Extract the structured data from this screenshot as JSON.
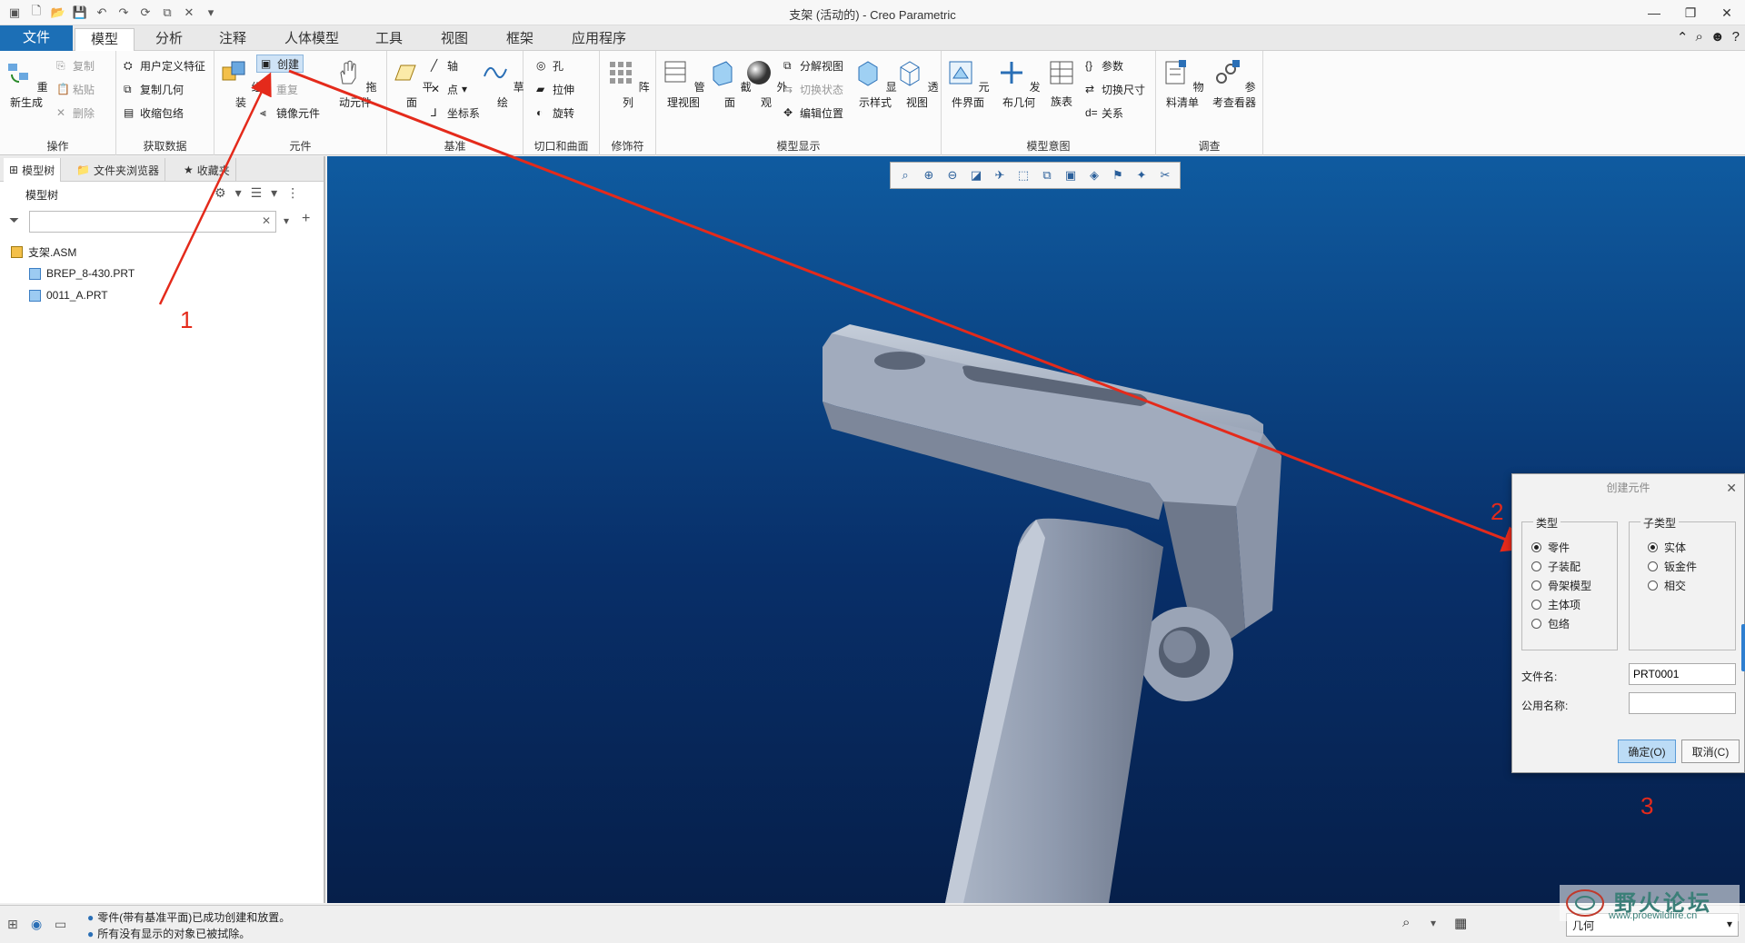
{
  "window": {
    "title": "支架 (活动的) - Creo Parametric"
  },
  "tabs": [
    "文件",
    "模型",
    "分析",
    "注释",
    "人体模型",
    "工具",
    "视图",
    "框架",
    "应用程序"
  ],
  "ribbon": {
    "operations": {
      "regen": "重新生成",
      "copy": "复制",
      "paste": "粘贴",
      "delete": "删除",
      "label": "操作"
    },
    "get_data": {
      "udf": "用户定义特征",
      "copy_geom": "复制几何",
      "shrinkwrap": "收缩包络",
      "label": "获取数据"
    },
    "component": {
      "assemble": "组装",
      "create": "创建",
      "repeat": "重复",
      "mirror": "镜像元件",
      "drag": "拖动元件",
      "label": "元件"
    },
    "datum": {
      "plane": "平面",
      "axis": "轴",
      "point": "点",
      "csys": "坐标系",
      "sketch": "草绘",
      "label": "基准"
    },
    "cut_surface": {
      "hole": "孔",
      "extrude": "拉伸",
      "revolve": "旋转",
      "label": "切口和曲面"
    },
    "modifiers": {
      "pattern": "阵列",
      "label": "修饰符"
    },
    "model_display": {
      "manage_views": "管理视图",
      "section": "截面",
      "appearance": "外观",
      "exploded": "分解视图",
      "toggle_status": "切换状态",
      "edit_position": "编辑位置",
      "display_style": "显示样式",
      "perspective": "透视图",
      "label": "模型显示"
    },
    "model_intent": {
      "interface": "元件界面",
      "publish": "发布几何",
      "family": "族表",
      "params": "参数",
      "switch_dims": "切换尺寸",
      "relations": "关系",
      "label": "模型意图"
    },
    "investigate": {
      "bom": "物料清单",
      "ref_viewer": "参考查看器",
      "label": "调查"
    }
  },
  "left_panel": {
    "tabs": [
      "模型树",
      "文件夹浏览器",
      "收藏夹"
    ],
    "tree_header": "模型树",
    "filter_placeholder": "",
    "tree": [
      "支架.ASM",
      "BREP_8-430.PRT",
      "0011_A.PRT"
    ]
  },
  "dialog": {
    "title": "创建元件",
    "type_label": "类型",
    "types": [
      "零件",
      "子装配",
      "骨架模型",
      "主体项",
      "包络"
    ],
    "type_selected": "零件",
    "subtype_label": "子类型",
    "subtypes": [
      "实体",
      "钣金件",
      "相交"
    ],
    "subtype_selected": "实体",
    "filename_label": "文件名:",
    "filename_value": "PRT0001",
    "common_name_label": "公用名称:",
    "common_name_value": "",
    "ok": "确定(O)",
    "cancel": "取消(C)"
  },
  "status": {
    "messages": [
      "零件(带有基准平面)已成功创建和放置。",
      "所有没有显示的对象已被拭除。"
    ],
    "filter": "几何"
  },
  "annotations": [
    "1",
    "2",
    "3"
  ],
  "watermark": {
    "text": "野火论坛",
    "url": "www.proewildfire.cn"
  },
  "colors": {
    "accent": "#1c6fb6",
    "viewport_top": "#0f5ba0",
    "viewport_bottom": "#061f4a",
    "annotation": "#e42a1b"
  }
}
